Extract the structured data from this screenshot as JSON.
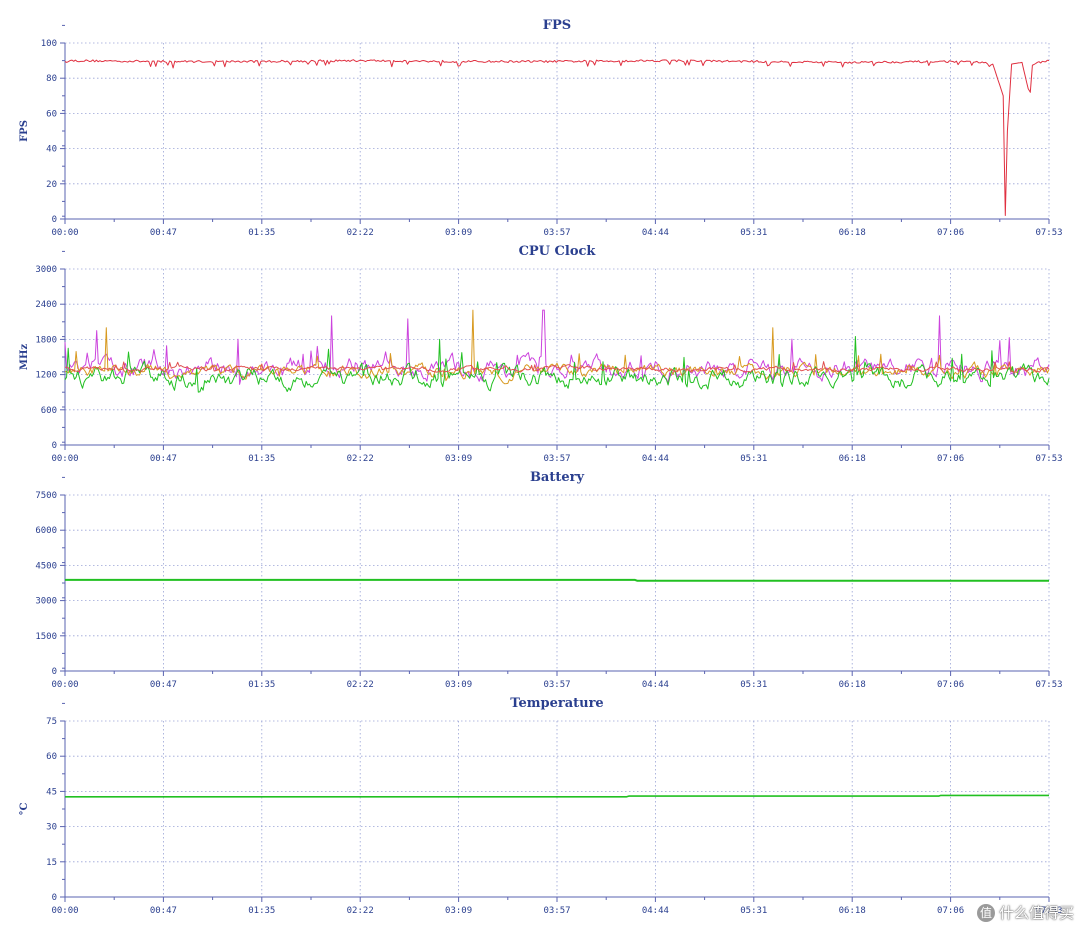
{
  "watermark": {
    "badge": "值",
    "text": "什么值得买"
  },
  "chart_data": [
    {
      "type": "line",
      "title": "FPS",
      "ylabel": "FPS",
      "xlabel": "",
      "ylim": [
        0,
        100
      ],
      "yticks": [
        "0",
        "20",
        "40",
        "60",
        "80",
        "100"
      ],
      "xticks": [
        "00:00",
        "00:47",
        "01:35",
        "02:22",
        "03:09",
        "03:57",
        "04:44",
        "05:31",
        "06:18",
        "07:06",
        "07:53"
      ],
      "grid": true,
      "series": [
        {
          "color": "#e03040",
          "base": 90,
          "noise": 0.6,
          "x": [
            0,
            47,
            95,
            142,
            189,
            237,
            284,
            331,
            378,
            426,
            440,
            446,
            451,
            452,
            453,
            455,
            460,
            463,
            464,
            465,
            473
          ],
          "y": [
            90,
            89.5,
            89.5,
            90,
            89.5,
            89.5,
            90,
            89.5,
            89,
            89.5,
            89,
            88,
            70,
            2,
            50,
            88,
            89,
            74,
            72,
            88,
            90
          ]
        }
      ]
    },
    {
      "type": "line",
      "title": "CPU Clock",
      "ylabel": "MHz",
      "xlabel": "",
      "ylim": [
        0,
        3000
      ],
      "yticks": [
        "0",
        "600",
        "1200",
        "1800",
        "2400",
        "3000"
      ],
      "xticks": [
        "00:00",
        "00:47",
        "01:35",
        "02:22",
        "03:09",
        "03:57",
        "04:44",
        "05:31",
        "06:18",
        "07:06",
        "07:53"
      ],
      "grid": true,
      "series": [
        {
          "color": "#cc44dd",
          "mean": 1300,
          "spread": 350,
          "spikes": [
            [
              15,
              1950
            ],
            [
              128,
              2200
            ],
            [
              165,
              2150
            ],
            [
              230,
              2300
            ],
            [
              420,
              2200
            ]
          ]
        },
        {
          "color": "#d89a20",
          "mean": 1250,
          "spread": 220,
          "spikes": [
            [
              20,
              2000
            ],
            [
              196,
              2300
            ],
            [
              340,
              2000
            ]
          ]
        },
        {
          "color": "#22c022",
          "mean": 1150,
          "spread": 330,
          "spikes": [
            [
              180,
              1800
            ],
            [
              380,
              1850
            ]
          ]
        },
        {
          "color": "#e05050",
          "mean": 1300,
          "spread": 80,
          "spikes": []
        }
      ]
    },
    {
      "type": "line",
      "title": "Battery",
      "ylabel": "",
      "xlabel": "",
      "ylim": [
        0,
        7500
      ],
      "yticks": [
        "0",
        "1500",
        "3000",
        "4500",
        "6000",
        "7500"
      ],
      "xticks": [
        "00:00",
        "00:47",
        "01:35",
        "02:22",
        "03:09",
        "03:57",
        "04:44",
        "05:31",
        "06:18",
        "07:06",
        "07:53"
      ],
      "grid": true,
      "series": [
        {
          "color": "#22c022",
          "x": [
            0,
            274,
            275,
            473
          ],
          "y": [
            3880,
            3880,
            3850,
            3850
          ],
          "width": 2
        }
      ]
    },
    {
      "type": "line",
      "title": "Temperature",
      "ylabel": "°C",
      "xlabel": "",
      "ylim": [
        0,
        75
      ],
      "yticks": [
        "0",
        "15",
        "30",
        "45",
        "60",
        "75"
      ],
      "xticks": [
        "00:00",
        "00:47",
        "01:35",
        "02:22",
        "03:09",
        "03:57",
        "04:44",
        "05:31",
        "06:18",
        "07:06",
        "07:53"
      ],
      "grid": true,
      "series": [
        {
          "color": "#22c022",
          "x": [
            0,
            270,
            271,
            420,
            421,
            473
          ],
          "y": [
            42.7,
            42.7,
            43.0,
            43.0,
            43.3,
            43.3
          ],
          "width": 1.6
        }
      ]
    }
  ]
}
